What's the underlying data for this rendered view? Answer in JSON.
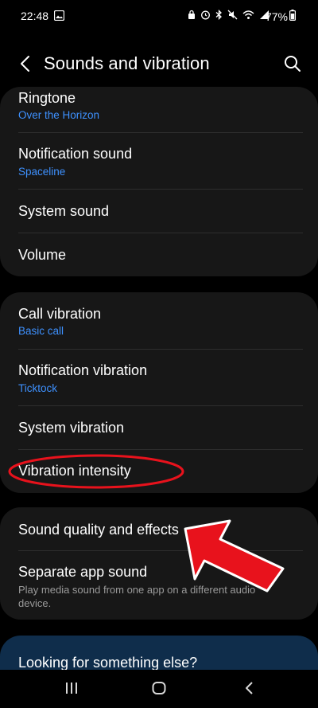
{
  "status_bar": {
    "time": "22:48",
    "battery": "77%",
    "icons": [
      "image-icon",
      "lock-icon",
      "alarm-icon",
      "bluetooth-icon",
      "mute-icon",
      "wifi-icon",
      "signal-icon",
      "battery-icon"
    ]
  },
  "header": {
    "title": "Sounds and vibration"
  },
  "sound_group": {
    "items": [
      {
        "title": "Ringtone",
        "subtitle": "Over the Horizon"
      },
      {
        "title": "Notification sound",
        "subtitle": "Spaceline"
      },
      {
        "title": "System sound"
      },
      {
        "title": "Volume"
      }
    ]
  },
  "vibration_group": {
    "items": [
      {
        "title": "Call vibration",
        "subtitle": "Basic call"
      },
      {
        "title": "Notification vibration",
        "subtitle": "Ticktock"
      },
      {
        "title": "System vibration"
      },
      {
        "title": "Vibration intensity"
      }
    ]
  },
  "quality_group": {
    "items": [
      {
        "title": "Sound quality and effects"
      },
      {
        "title": "Separate app sound",
        "description": "Play media sound from one app on a different audio device."
      }
    ]
  },
  "promo": {
    "title": "Looking for something else?"
  },
  "colors": {
    "background": "#000000",
    "card": "#171717",
    "accent_blue": "#3e91ff",
    "annotation_red": "#e8121c",
    "promo_bg": "#0f2d4b"
  }
}
